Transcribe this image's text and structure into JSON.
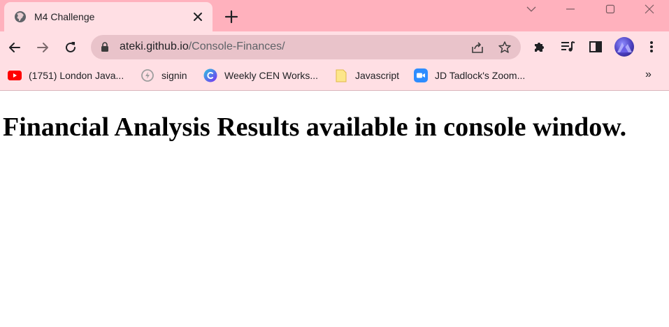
{
  "browser": {
    "tab": {
      "title": "M4 Challenge",
      "favicon": "globe-icon"
    },
    "address": {
      "host": "ateki.github.io",
      "path": "/Console-Finances/"
    },
    "colors": {
      "frame": "#ffb1bd",
      "toolbar": "#ffdfe4",
      "omnibox": "#e9c3ca"
    }
  },
  "bookmarks": [
    {
      "label": "(1751) London Java...",
      "icon": "youtube-icon"
    },
    {
      "label": "signin",
      "icon": "signin-icon"
    },
    {
      "label": "Weekly CEN Works...",
      "icon": "canva-icon"
    },
    {
      "label": "Javascript",
      "icon": "folder-icon"
    },
    {
      "label": "JD Tadlock's Zoom...",
      "icon": "zoom-icon"
    }
  ],
  "bookmarks_overflow": "»",
  "page": {
    "heading": "Financial Analysis Results available in console window."
  }
}
